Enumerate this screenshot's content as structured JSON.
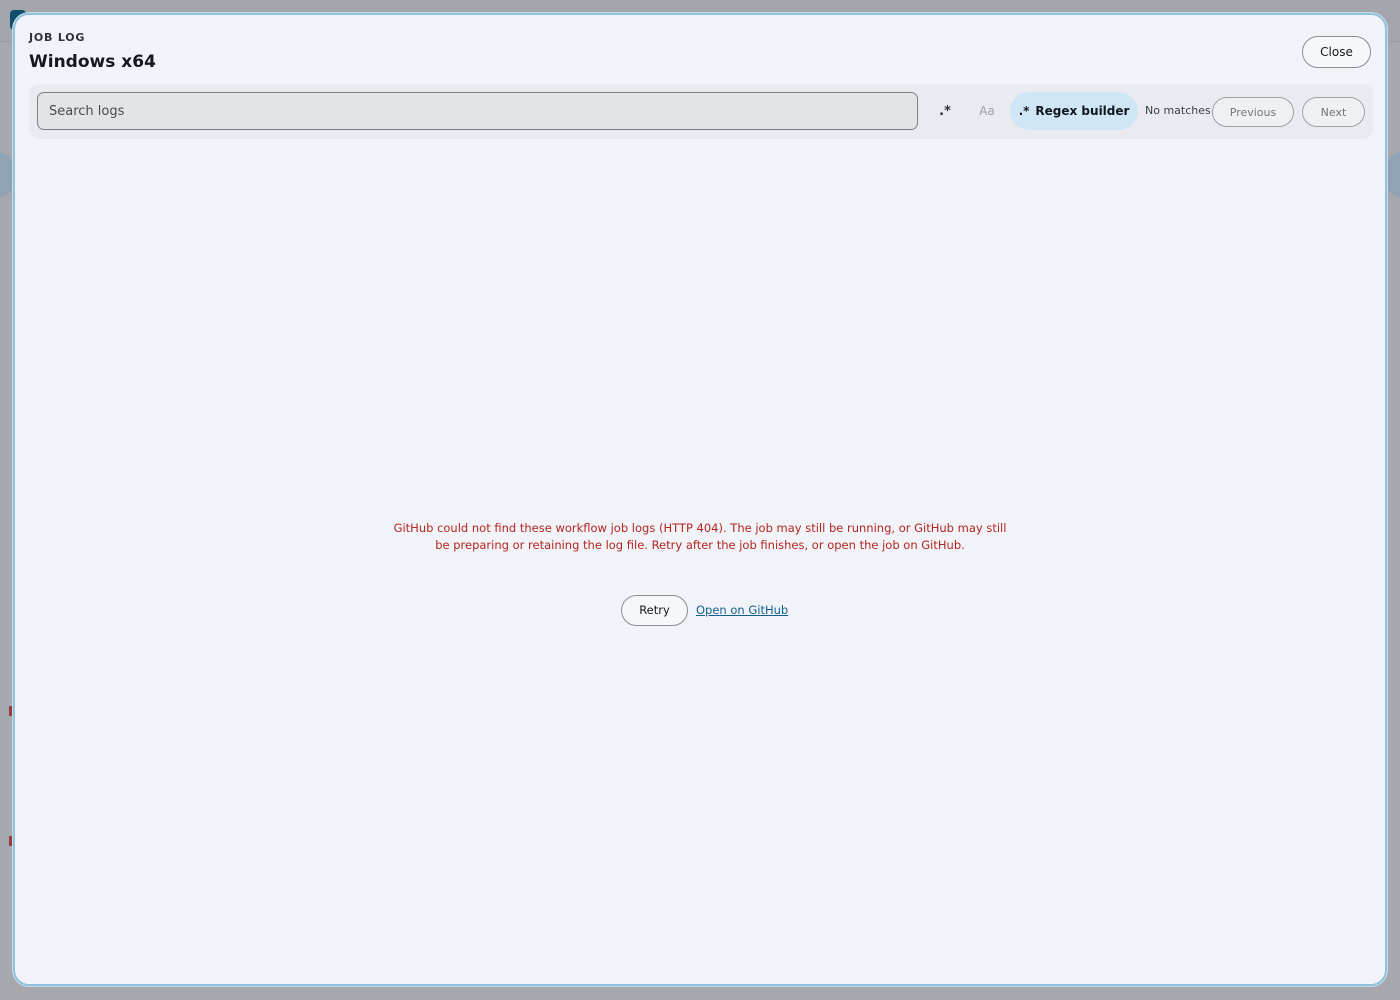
{
  "modal": {
    "eyebrow": "JOB LOG",
    "title": "Windows x64",
    "close_label": "Close"
  },
  "toolbar": {
    "search_placeholder": "Search logs",
    "regex_toggle_label": ".*",
    "case_toggle_label": "Aa",
    "regex_builder_icon": ".*",
    "regex_builder_label": "Regex builder",
    "match_status": "No matches",
    "previous_label": "Previous",
    "next_label": "Next"
  },
  "error": {
    "message": "GitHub could not find these workflow job logs (HTTP 404). The job may still be running, or GitHub may still be preparing or retaining the log file. Retry after the job finishes, or open the job on GitHub.",
    "retry_label": "Retry",
    "open_link_label": "Open on GitHub"
  },
  "colors": {
    "error_text": "#b3261e",
    "accent_pill": "#cfe6f7",
    "link": "#0f5f8f",
    "modal_border": "#8fc2dd"
  }
}
